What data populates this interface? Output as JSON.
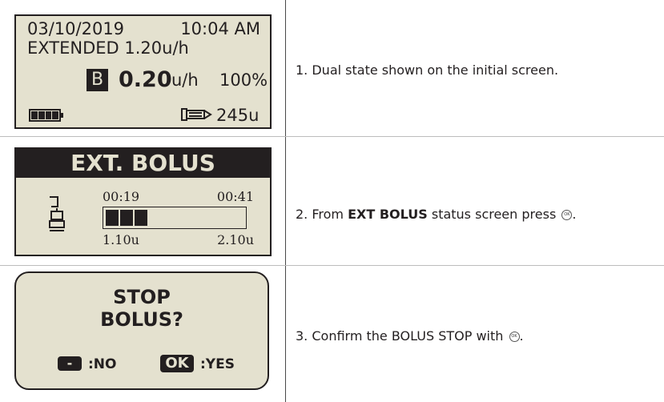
{
  "screen1": {
    "date": "03/10/2019",
    "time": "10:04 AM",
    "extended": "EXTENDED 1.20u/h",
    "b_label": "B",
    "rate": "0.20",
    "rate_unit": "u/h",
    "percent": "100%",
    "reservoir": "245u",
    "battery_level": 1.0
  },
  "screen2": {
    "title": "EXT. BOLUS",
    "elapsed": "00:19",
    "remaining": "00:41",
    "delivered": "1.10u",
    "total": "2.10u",
    "progress_segments": 3
  },
  "screen3": {
    "question_line1": "STOP",
    "question_line2": "BOLUS?",
    "minus_key": "-",
    "no_label": ":NO",
    "ok_key": "OK",
    "yes_label": ":YES"
  },
  "steps": [
    {
      "text": "1. Dual state shown on the initial screen."
    },
    {
      "pre": "2. From ",
      "bold": "EXT BOLUS",
      "post": " status screen press",
      "end": "."
    },
    {
      "pre": "3. Confirm the BOLUS STOP with",
      "end": "."
    }
  ],
  "ok_glyph": "OK",
  "colors": {
    "lcd_background": "#e4e1cf",
    "ink": "#231f20"
  }
}
